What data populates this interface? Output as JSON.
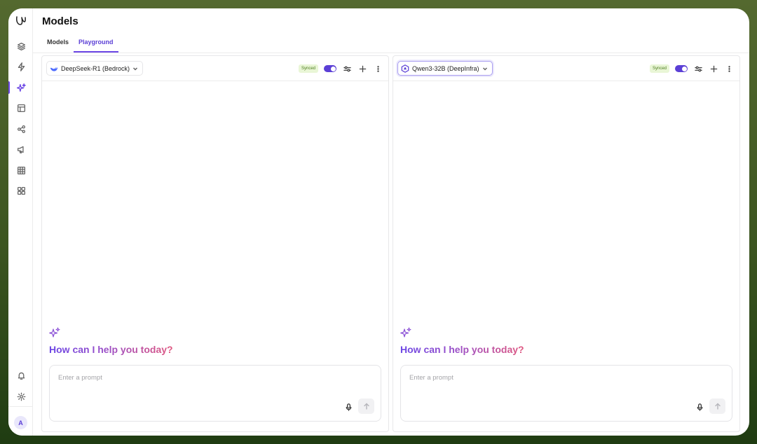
{
  "page": {
    "title": "Models"
  },
  "tabs": [
    {
      "label": "Models",
      "active": false
    },
    {
      "label": "Playground",
      "active": true
    }
  ],
  "sidebar": {
    "logo": "logo-icon",
    "items": [
      {
        "icon": "layers-icon"
      },
      {
        "icon": "bolt-icon"
      },
      {
        "icon": "sparkles-icon",
        "active": true
      },
      {
        "icon": "layout-icon"
      },
      {
        "icon": "share-icon"
      },
      {
        "icon": "megaphone-icon"
      },
      {
        "icon": "table-icon"
      },
      {
        "icon": "grid-icon"
      }
    ],
    "bottom": [
      {
        "icon": "bell-icon"
      },
      {
        "icon": "gear-icon"
      }
    ],
    "avatar_initial": "A"
  },
  "panels": [
    {
      "model": "DeepSeek-R1 (Bedrock)",
      "model_icon": "deepseek-whale-icon",
      "synced_label": "Synced",
      "synced_on": true,
      "welcome": "How can I help you today?",
      "prompt_placeholder": "Enter a prompt",
      "prompt_value": ""
    },
    {
      "model": "Qwen3-32B (DeepInfra)",
      "model_icon": "qwen-icon",
      "synced_label": "Synced",
      "synced_on": true,
      "welcome": "How can I help you today?",
      "prompt_placeholder": "Enter a prompt",
      "prompt_value": ""
    }
  ],
  "colors": {
    "accent": "#6b46e5",
    "gradient_start": "#6b46e5",
    "gradient_end": "#e0577f",
    "synced_bg": "#e9f6d6",
    "synced_text": "#4a7a1c"
  }
}
